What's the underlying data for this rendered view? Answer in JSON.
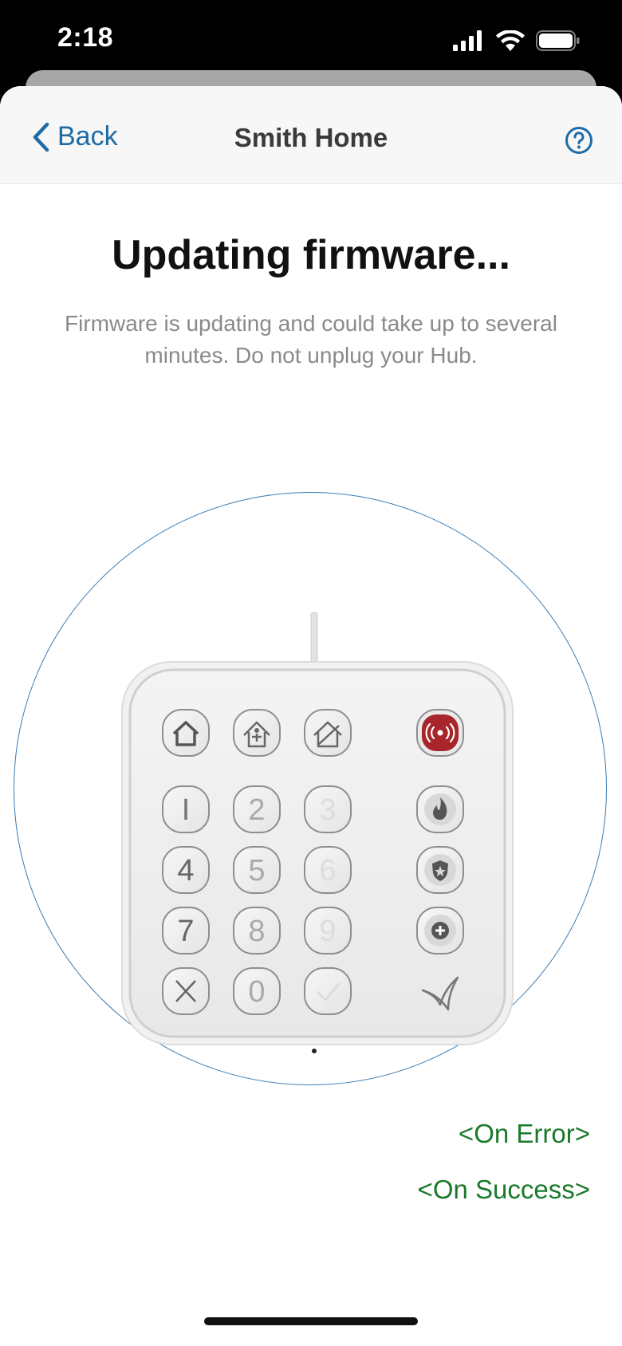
{
  "status_bar": {
    "time": "2:18",
    "icons": [
      "cellular-signal-icon",
      "wifi-icon",
      "battery-icon"
    ]
  },
  "nav": {
    "back_label": "Back",
    "title": "Smith Home",
    "help_icon": "question-circle-icon"
  },
  "content": {
    "title": "Updating firmware...",
    "subtitle": "Firmware is updating and could take up to several minutes. Do not unplug your Hub."
  },
  "keypad": {
    "mode_icons": [
      "home-mode-icon",
      "stay-mode-icon",
      "away-mode-icon",
      "siren-alarm-icon"
    ],
    "keys": [
      "1",
      "2",
      "3",
      "4",
      "5",
      "6",
      "7",
      "8",
      "9",
      "X",
      "0",
      "check"
    ],
    "side_icons": [
      "fire-icon",
      "police-badge-icon",
      "medical-plus-icon",
      "brand-logo-icon"
    ]
  },
  "links": {
    "on_error": "<On Error>",
    "on_success": "<On Success>"
  },
  "colors": {
    "accent_blue": "#1f6ba5",
    "link_green": "#1a7a2a",
    "alarm_red": "#a8262b",
    "circle_stroke": "#3b7bb2"
  }
}
